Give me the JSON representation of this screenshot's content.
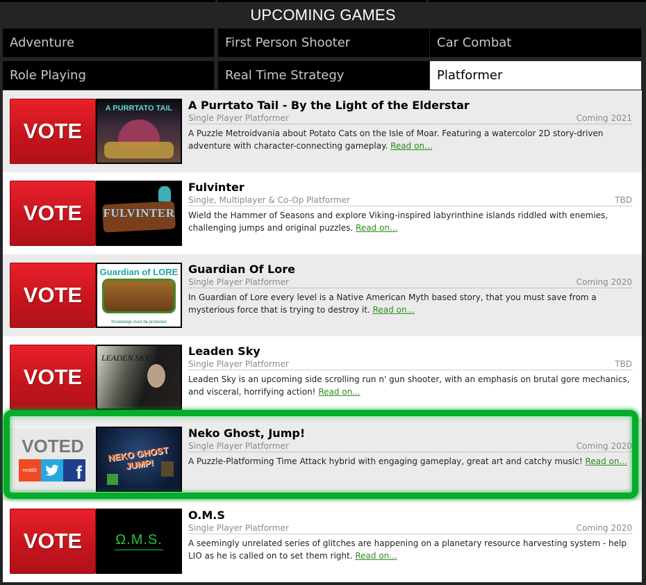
{
  "header": {
    "title": "UPCOMING GAMES"
  },
  "tabs": [
    {
      "label": "Adventure",
      "active": false
    },
    {
      "label": "First Person Shooter",
      "active": false
    },
    {
      "label": "Car Combat",
      "active": false
    },
    {
      "label": "Role Playing",
      "active": false
    },
    {
      "label": "Real Time Strategy",
      "active": false
    },
    {
      "label": "Platformer",
      "active": true
    }
  ],
  "games": [
    {
      "vote_label": "VOTE",
      "thumb_text": "A PURRTATO TAIL",
      "title": "A Purrtato Tail - By the Light of the Elderstar",
      "genre": "Single Player Platformer",
      "release": "Coming 2021",
      "description": "A Puzzle Metroidvania about Potato Cats on the Isle of Moar. Featuring a watercolor 2D story-driven adventure with character-connecting gameplay.",
      "read_on": "Read on..."
    },
    {
      "vote_label": "VOTE",
      "thumb_text": "FULVINTER",
      "title": "Fulvinter",
      "genre": "Single, Multiplayer & Co-Op Platformer",
      "release": "TBD",
      "description": "Wield the Hammer of Seasons and explore Viking-inspired labyrinthine islands riddled with enemies, challenging jumps and original puzzles.",
      "read_on": "Read on..."
    },
    {
      "vote_label": "VOTE",
      "thumb_text": "Guardian of LORE",
      "thumb_subtext": "Knowledge must be protected",
      "title": "Guardian Of Lore",
      "genre": "Single Player Platformer",
      "release": "Coming 2020",
      "description": "In Guardian of Lore every level is a Native American Myth based story, that you must save from a mysterious force that is trying to destroy it.",
      "read_on": "Read on..."
    },
    {
      "vote_label": "VOTE",
      "thumb_text": "LEADEN SKY",
      "title": "Leaden Sky",
      "genre": "Single Player Platformer",
      "release": "TBD",
      "description": "Leaden Sky is an upcoming side scrolling run n' gun shooter, with an emphasis on brutal gore mechanics, and visceral, horrifying action!",
      "read_on": "Read on..."
    },
    {
      "voted_label": "VOTED",
      "share": {
        "reddit": "reddit",
        "twitter": "twitter-icon",
        "facebook": "f"
      },
      "thumb_text": "NEKO GHOST JUMP!",
      "title": "Neko Ghost, Jump!",
      "genre": "Single Player Platformer",
      "release": "Coming 2020",
      "description": "A Puzzle-Platforming Time Attack hybrid with engaging gameplay, great art and catchy music!",
      "read_on": "Read on..."
    },
    {
      "vote_label": "VOTE",
      "thumb_text": "Ω.M.S.",
      "title": "O.M.S",
      "genre": "Single Player Platformer",
      "release": "Coming 2020",
      "description": "A seemingly unrelated series of glitches are happening on a planetary resource harvesting system - help LIO as he is called on to set them right.",
      "read_on": "Read on..."
    }
  ],
  "colors": {
    "vote_red": "#d81a22",
    "highlight_green": "#05ad2a",
    "link_green": "#2e8b1e",
    "reddit": "#f04a22",
    "twitter": "#26a8e1",
    "facebook": "#1f3f8a"
  }
}
